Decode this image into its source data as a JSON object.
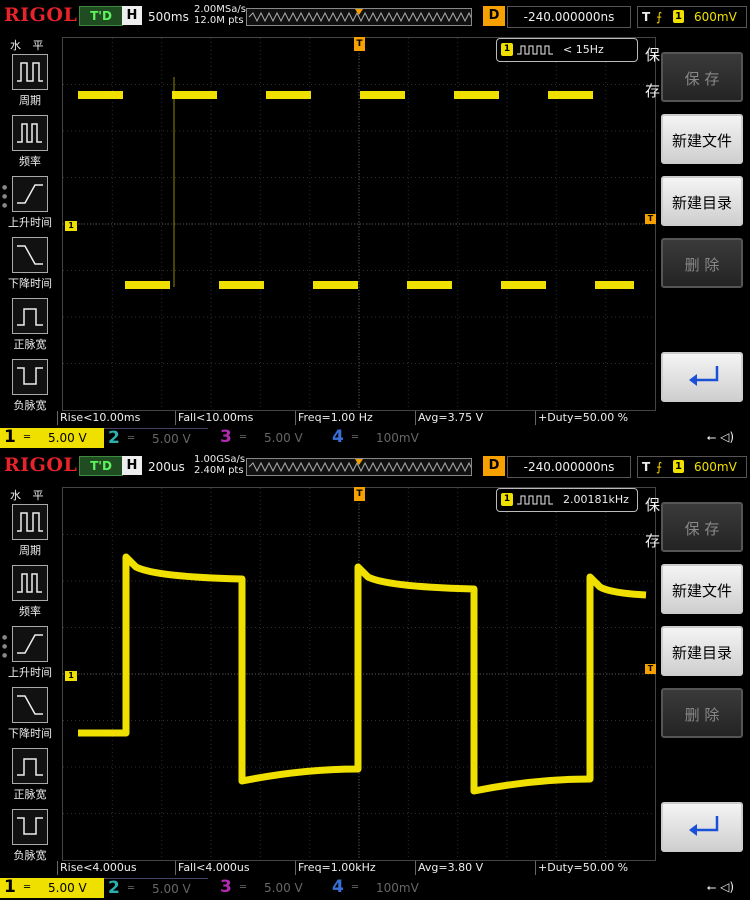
{
  "panels": [
    {
      "logo": "RIGOL",
      "trigger_status": "T'D",
      "horizontal_label": "H",
      "timebase": "500ms",
      "sample_rate": "2.00MSa/s",
      "memory_depth": "12.0M pts",
      "delay_label": "D",
      "delay": "-240.000000ns",
      "trigger": {
        "label": "T",
        "channel": "1",
        "level": "600mV"
      },
      "left_menu": {
        "title": "水 平",
        "items": [
          "周期",
          "频率",
          "上升时间",
          "下降时间",
          "正脉宽",
          "负脉宽"
        ]
      },
      "ch1_marker": "1",
      "trigger_marker": "T",
      "freq_counter": {
        "channel": "1",
        "value": "< 15Hz"
      },
      "measurements": [
        "Rise<10.00ms",
        "Fall<10.00ms",
        "Freq=1.00 Hz",
        "Avg=3.75 V",
        "+Duty=50.00 %"
      ],
      "channels": [
        {
          "num": "1",
          "scale": "5.00 V"
        },
        {
          "num": "2",
          "scale": "5.00 V"
        },
        {
          "num": "3",
          "scale": "5.00 V"
        },
        {
          "num": "4",
          "scale": "100mV"
        }
      ],
      "usb_icon": "usb-icon",
      "softkeys": {
        "side_label_1": "保",
        "side_label_2": "存",
        "save": "保 存",
        "new_file": "新建文件",
        "new_dir": "新建目录",
        "delete": "删 除"
      },
      "waveform": {
        "frequency_hz": 1.0,
        "duty": 0.5
      }
    },
    {
      "logo": "RIGOL",
      "trigger_status": "T'D",
      "horizontal_label": "H",
      "timebase": "200us",
      "sample_rate": "1.00GSa/s",
      "memory_depth": "2.40M pts",
      "delay_label": "D",
      "delay": "-240.000000ns",
      "trigger": {
        "label": "T",
        "channel": "1",
        "level": "600mV"
      },
      "left_menu": {
        "title": "水 平",
        "items": [
          "周期",
          "频率",
          "上升时间",
          "下降时间",
          "正脉宽",
          "负脉宽"
        ]
      },
      "ch1_marker": "1",
      "trigger_marker": "T",
      "freq_counter": {
        "channel": "1",
        "value": "2.00181kHz"
      },
      "measurements": [
        "Rise<4.000us",
        "Fall<4.000us",
        "Freq=1.00kHz",
        "Avg=3.80 V",
        "+Duty=50.00 %"
      ],
      "channels": [
        {
          "num": "1",
          "scale": "5.00 V"
        },
        {
          "num": "2",
          "scale": "5.00 V"
        },
        {
          "num": "3",
          "scale": "5.00 V"
        },
        {
          "num": "4",
          "scale": "100mV"
        }
      ],
      "usb_icon": "usb-icon",
      "softkeys": {
        "side_label_1": "保",
        "side_label_2": "存",
        "save": "保 存",
        "new_file": "新建文件",
        "new_dir": "新建目录",
        "delete": "删 除"
      },
      "waveform": {
        "frequency_hz": 1000,
        "duty": 0.5
      }
    }
  ],
  "colors": {
    "ch1": "#f0e000",
    "ch2": "#2bb0b0",
    "ch3": "#b02bb0",
    "ch4": "#3a6fd8",
    "trigger": "#f6a100",
    "logo": "#e8232a"
  }
}
